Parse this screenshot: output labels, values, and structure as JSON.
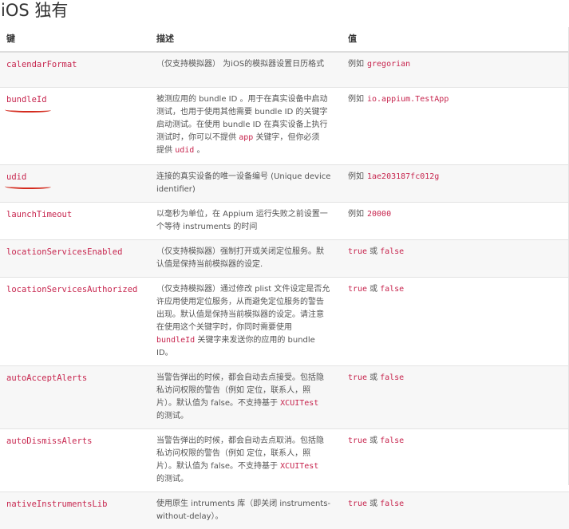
{
  "page_title": "iOS 独有",
  "table": {
    "headers": {
      "key": "键",
      "description": "描述",
      "value": "值"
    },
    "rows": [
      {
        "key": "calendarFormat",
        "desc": [
          "（仅支持模拟器） 为iOS的模拟器设置日历格式"
        ],
        "val_prefix": "例如",
        "val_code": "gregorian"
      },
      {
        "key": "bundleId",
        "desc": [
          "被测应用的 bundle ID 。用于在真实设备中启动",
          "测试，也用于使用其他需要 bundle ID 的关键字",
          "启动测试。在使用 bundle ID 在真实设备上执行",
          "测试时，你可以不提供"
        ],
        "desc_code": "app",
        "desc_after": "关键字，但你必须",
        "desc_tail": "提供",
        "desc_tail_code": "udid",
        "desc_tail_end": "。",
        "val_prefix": "例如",
        "val_code": "io.appium.TestApp"
      },
      {
        "key": "udid",
        "desc": [
          "连接的真实设备的唯一设备编号 (Unique device",
          "identifier)"
        ],
        "val_prefix": "例如",
        "val_code": "1ae203187fc012g"
      },
      {
        "key": "launchTimeout",
        "desc": [
          "以毫秒为单位，在 Appium 运行失败之前设置一",
          "个等待 instruments 的时间"
        ],
        "val_prefix": "例如",
        "val_code": "20000"
      },
      {
        "key": "locationServicesEnabled",
        "desc": [
          "（仅支持模拟器）强制打开或关闭定位服务。默",
          "认值是保持当前模拟器的设定."
        ],
        "val_true": "true",
        "val_or": "或",
        "val_false": "false"
      },
      {
        "key": "locationServicesAuthorized",
        "desc": [
          "（仅支持模拟器）通过修改 plist 文件设定是否允",
          "许应用使用定位服务，从而避免定位服务的警告",
          "出现。默认值是保持当前模拟器的设定。请注意",
          "在使用这个关键字时，你同时需要使用"
        ],
        "desc_line5_code": "bundleId",
        "desc_line5_rest": "关键字来发送你的应用的 bundle",
        "desc_line6": "ID。",
        "val_true": "true",
        "val_or": "或",
        "val_false": "false"
      },
      {
        "key": "autoAcceptAlerts",
        "desc": [
          "当警告弹出的时候，都会自动去点接受。包括隐",
          "私访问权限的警告（例如 定位，联系人，照",
          "片）。默认值为 false。不支持基于"
        ],
        "desc_code": "XCUITest",
        "desc_last": "的测试。",
        "val_true": "true",
        "val_or": "或",
        "val_false": "false"
      },
      {
        "key": "autoDismissAlerts",
        "desc": [
          "当警告弹出的时候，都会自动去点取消。包括隐",
          "私访问权限的警告（例如 定位，联系人，照",
          "片）。默认值为 false。不支持基于"
        ],
        "desc_code": "XCUITest",
        "desc_last": "的测试。",
        "val_true": "true",
        "val_or": "或",
        "val_false": "false"
      },
      {
        "key": "nativeInstrumentsLib",
        "desc": [
          "使用原生 intruments 库（即关闭 instruments-",
          "without-delay）。"
        ],
        "val_true": "true",
        "val_or": "或",
        "val_false": "false"
      }
    ]
  },
  "annotations": {
    "underline_color": "#d42b1e",
    "underlined_keys": [
      "bundleId",
      "udid"
    ]
  },
  "colors": {
    "code": "#c7254e",
    "stripe": "#f7f7f7",
    "border": "#e3e3e3"
  }
}
